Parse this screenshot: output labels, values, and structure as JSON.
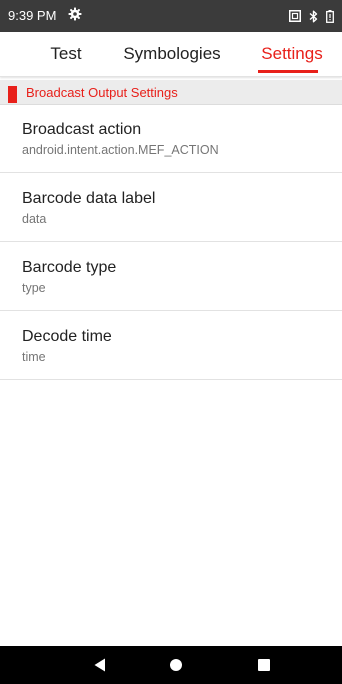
{
  "status_bar": {
    "time": "9:39 PM",
    "icons": [
      "settings-gear-icon",
      "screenshot-icon",
      "bluetooth-icon",
      "battery-icon"
    ]
  },
  "tabs": [
    {
      "label": "Test",
      "active": false
    },
    {
      "label": "Symbologies",
      "active": false
    },
    {
      "label": "Settings",
      "active": true
    }
  ],
  "section": {
    "title": "Broadcast Output Settings"
  },
  "preferences": [
    {
      "title": "Broadcast action",
      "summary": "android.intent.action.MEF_ACTION"
    },
    {
      "title": "Barcode data label",
      "summary": "data"
    },
    {
      "title": "Barcode type",
      "summary": "type"
    },
    {
      "title": "Decode time",
      "summary": "time"
    }
  ],
  "nav_bar": {
    "icons": [
      "back-icon",
      "home-icon",
      "recents-icon"
    ]
  },
  "colors": {
    "accent": "#e8201a",
    "status_bar": "#3b3b3b",
    "section_background": "#ececec",
    "nav_bar": "#000000"
  }
}
